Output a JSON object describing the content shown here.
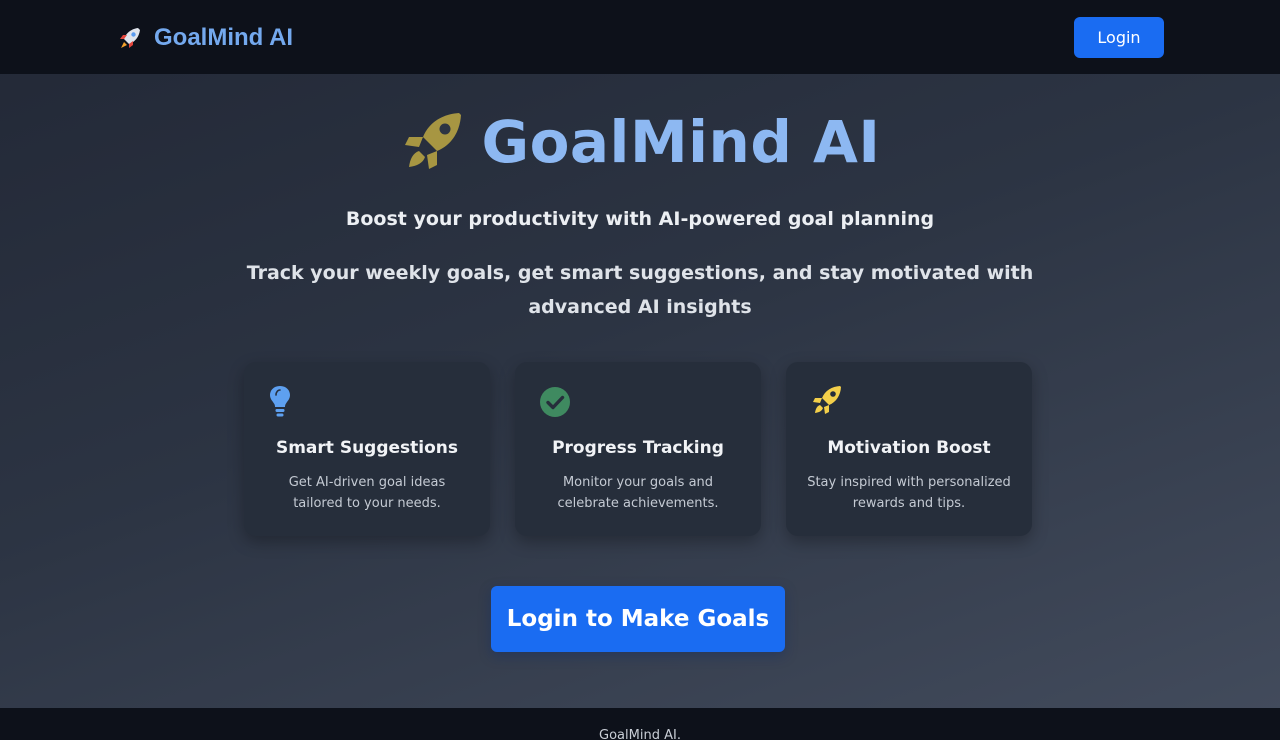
{
  "navbar": {
    "brand_icon": "rocket-icon",
    "brand_text": "GoalMind AI",
    "login_label": "Login"
  },
  "hero": {
    "icon": "rocket-icon",
    "title": "GoalMind AI",
    "subtitle": "Boost your productivity with AI-powered goal planning",
    "description": "Track your weekly goals, get smart suggestions, and stay motivated with advanced AI insights"
  },
  "features": [
    {
      "icon": "lightbulb-icon",
      "icon_color": "#5ea0f0",
      "title": "Smart Suggestions",
      "description": "Get AI-driven goal ideas tailored to your needs."
    },
    {
      "icon": "check-circle-icon",
      "icon_color": "#3f8a60",
      "title": "Progress Tracking",
      "description": "Monitor your goals and celebrate achievements."
    },
    {
      "icon": "rocket-icon",
      "icon_color": "#f3cf4a",
      "title": "Motivation Boost",
      "description": "Stay inspired with personalized rewards and tips."
    }
  ],
  "cta": {
    "label": "Login to Make Goals"
  },
  "footer": {
    "text": "GoalMind AI."
  },
  "colors": {
    "accent": "#1a6cf2",
    "brand_text": "#74a9ee",
    "hero_title": "#8db8f2",
    "hero_rocket": "#a79642",
    "navbar_bg": "#0d111a"
  }
}
